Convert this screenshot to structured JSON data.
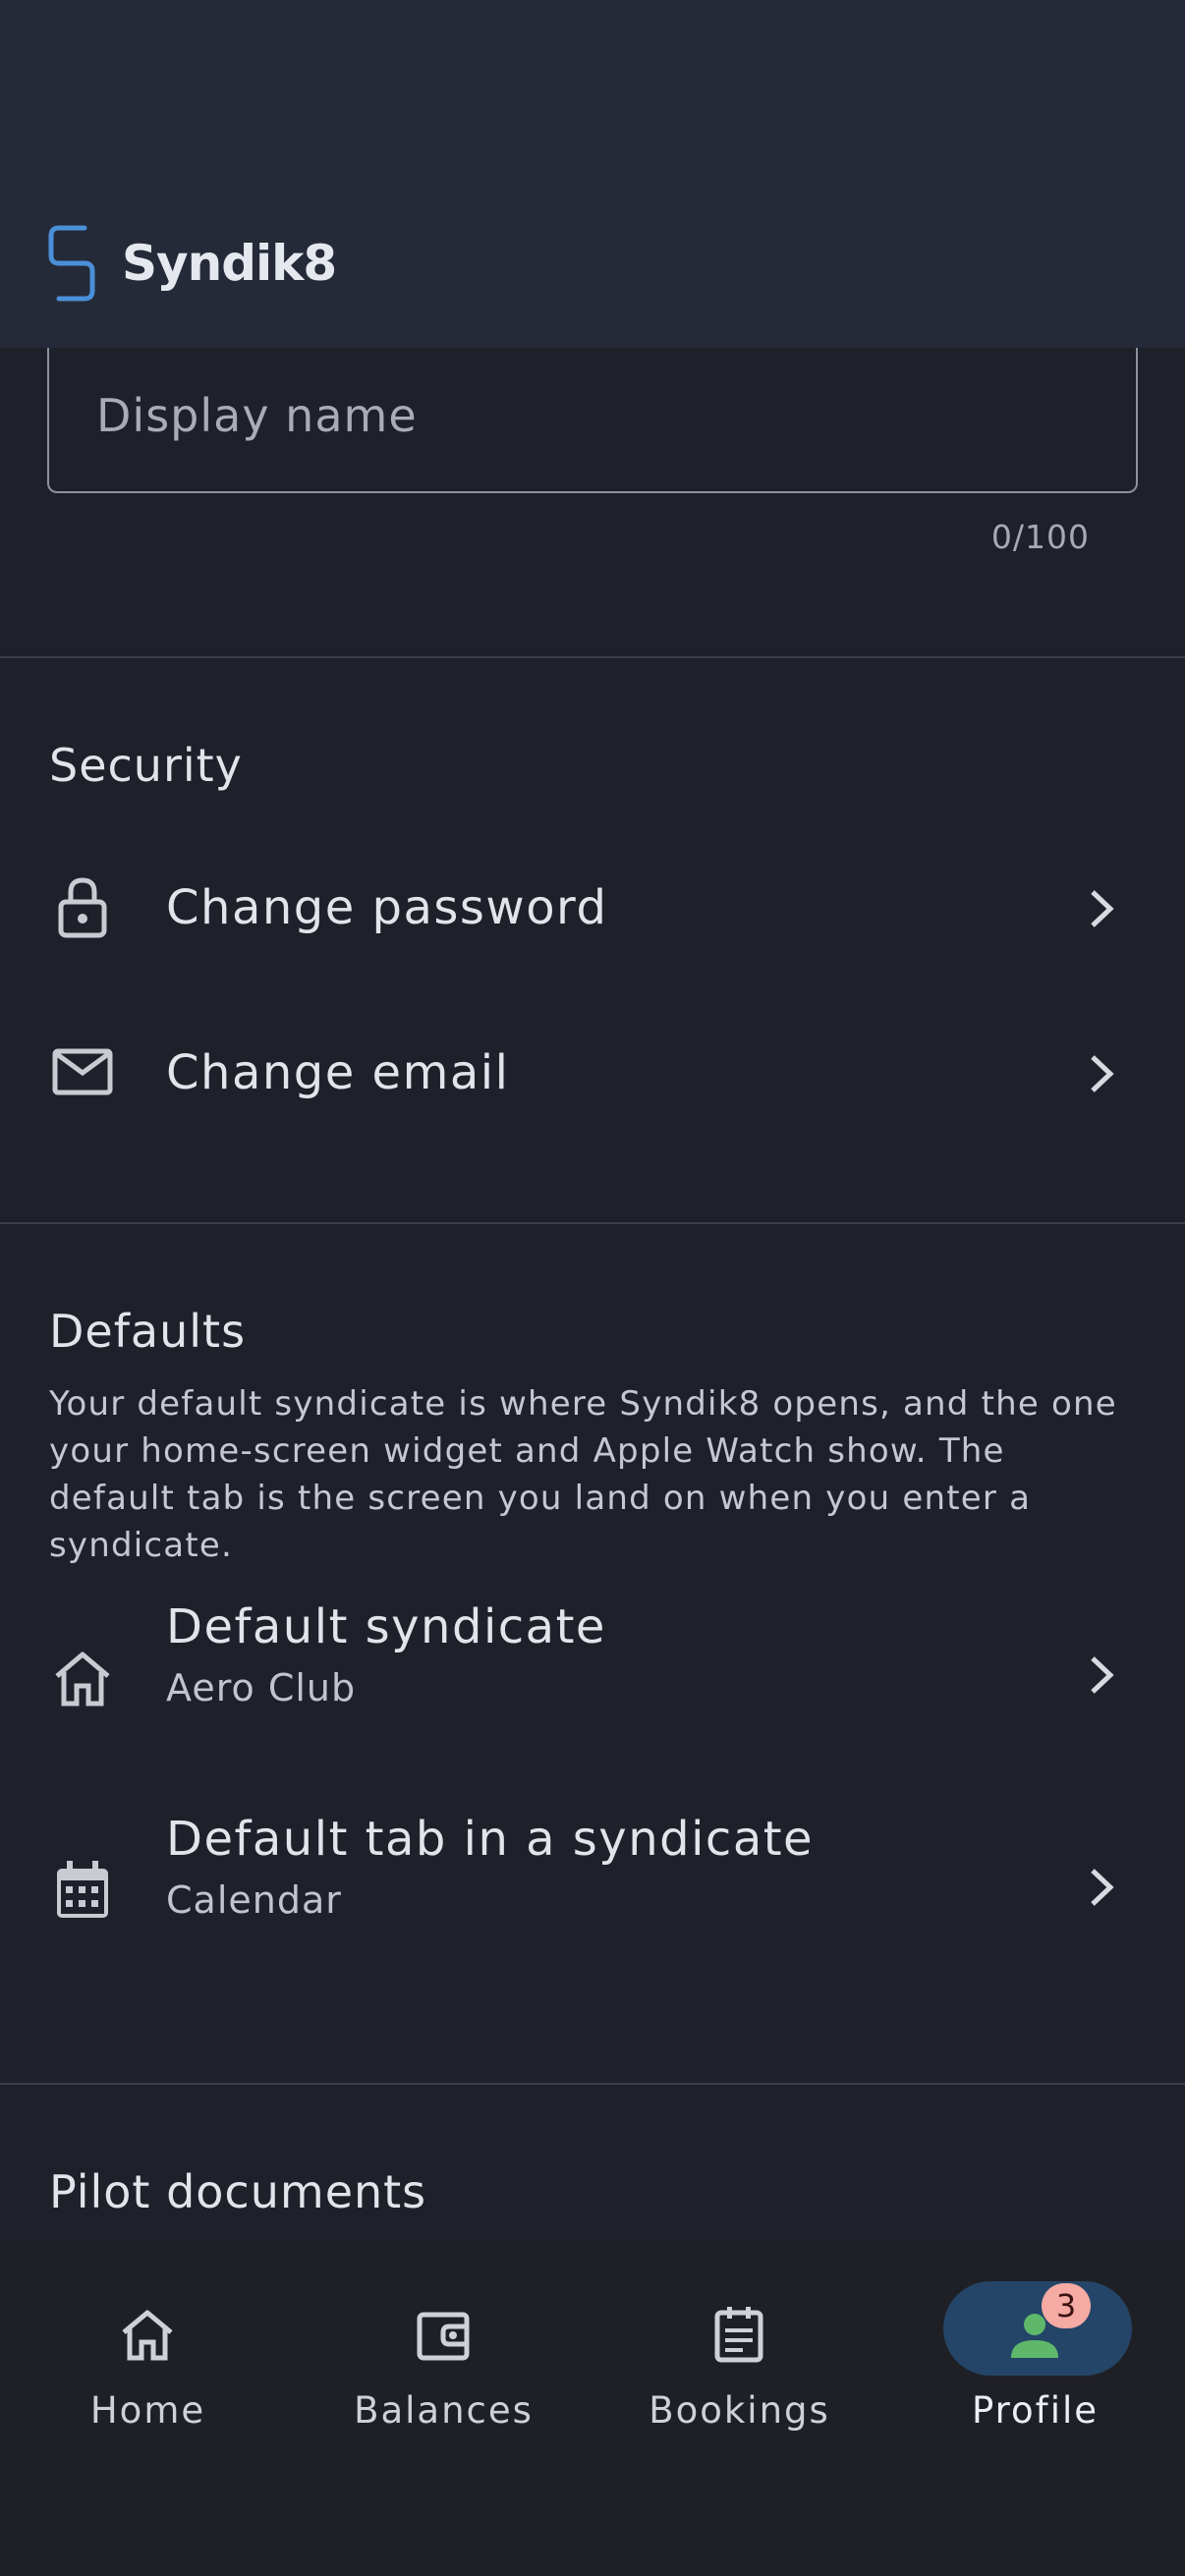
{
  "app": {
    "name": "Syndik8"
  },
  "profile": {
    "display_name_placeholder": "Display name",
    "display_name_counter": "0/100"
  },
  "security": {
    "title": "Security",
    "items": [
      {
        "label": "Change password",
        "icon": "lock-icon"
      },
      {
        "label": "Change email",
        "icon": "envelope-icon"
      }
    ]
  },
  "defaults": {
    "title": "Defaults",
    "description": "Your default syndicate is where Syndik8 opens, and the one your home-screen widget and Apple Watch show. The default tab is the screen you land on when you enter a syndicate.",
    "items": [
      {
        "label": "Default syndicate",
        "value": "Aero Club",
        "icon": "home-icon"
      },
      {
        "label": "Default tab in a syndicate",
        "value": "Calendar",
        "icon": "calendar-icon"
      }
    ]
  },
  "pilot_documents": {
    "title": "Pilot documents"
  },
  "nav": {
    "items": [
      {
        "label": "Home",
        "icon": "home-icon"
      },
      {
        "label": "Balances",
        "icon": "wallet-icon"
      },
      {
        "label": "Bookings",
        "icon": "clipboard-icon"
      },
      {
        "label": "Profile",
        "icon": "person-icon",
        "active": true,
        "badge": "3"
      }
    ]
  },
  "colors": {
    "background": "#1e202a",
    "header": "#252a38",
    "accent": "#4a90d9",
    "active_pill": "#244567",
    "badge": "#f5aaa3",
    "profile_icon": "#5fb86a"
  }
}
